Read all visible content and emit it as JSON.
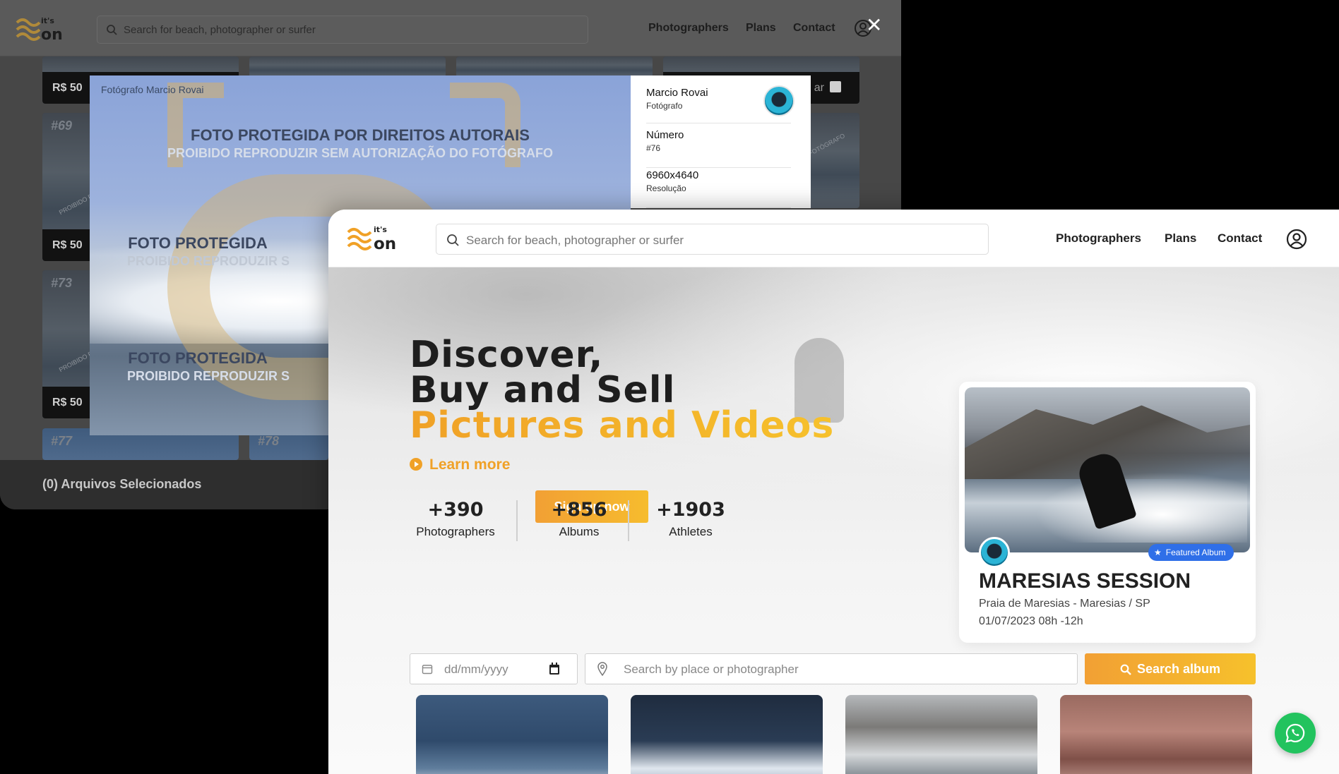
{
  "back": {
    "search_placeholder": "Search for beach, photographer or surfer",
    "nav": [
      "Photographers",
      "Plans",
      "Contact"
    ],
    "cards": [
      {
        "num": "",
        "price": "R$ 50"
      },
      {
        "num": "#69",
        "price": "R$ 50"
      },
      {
        "num": "#73",
        "price": "R$ 50"
      },
      {
        "num": "#77",
        "price": ""
      },
      {
        "num": "#78",
        "price": ""
      }
    ],
    "select_label": "ar",
    "watermark_small": "PROIBIDO REPRODUZIR",
    "watermark_photographer": "FOTÓGRAFO",
    "footer": "(0) Arquivos Selecionados",
    "modal": {
      "caption": "Fotógrafo Marcio Rovai",
      "wm_title": "FOTO PROTEGIDA POR DIREITOS AUTORAIS",
      "wm_sub": "PROIBIDO REPRODUZIR SEM AUTORIZAÇÃO DO FOTÓGRAFO",
      "wm_title_short": "FOTO PROTEGIDA",
      "wm_sub_short": "PROIBIDO REPRODUZIR S",
      "side": [
        {
          "title": "Marcio Rovai",
          "sub": "Fotógrafo"
        },
        {
          "title": "Número",
          "sub": "#76"
        },
        {
          "title": "6960x4640",
          "sub": "Resolução"
        }
      ]
    }
  },
  "front": {
    "search_placeholder": "Search for beach, photographer or surfer",
    "nav": [
      "Photographers",
      "Plans",
      "Contact"
    ],
    "hero": {
      "line1": "Discover,",
      "line2": "Buy and Sell",
      "line3": "Pictures and Videos",
      "learn_more": "Learn more",
      "signup": "Sign up now"
    },
    "stats": [
      {
        "value": "+390",
        "label": "Photographers"
      },
      {
        "value": "+856",
        "label": "Albums"
      },
      {
        "value": "+1903",
        "label": "Athletes"
      }
    ],
    "featured": {
      "badge": "Featured Album",
      "title": "MARESIAS SESSION",
      "location": "Praia de Maresias - Maresias / SP",
      "datetime": "01/07/2023 08h -12h"
    },
    "filter": {
      "date_placeholder": "dd/mm/yyyy",
      "place_placeholder": "Search by place or photographer",
      "button": "Search album"
    }
  },
  "colors": {
    "accent": "#f0a127",
    "accent2": "#f6c12c",
    "badge": "#2f6fe8",
    "whatsapp": "#22c35e"
  }
}
